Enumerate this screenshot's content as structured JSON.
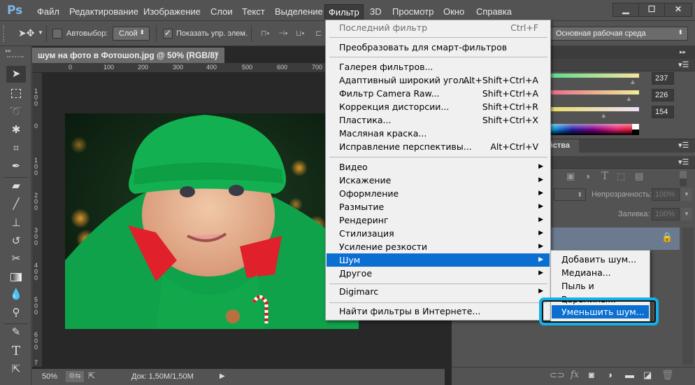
{
  "app": {
    "logo": "Ps"
  },
  "menubar": {
    "items": [
      "Файл",
      "Редактирование",
      "Изображение",
      "Слои",
      "Текст",
      "Выделение",
      "Фильтр",
      "3D",
      "Просмотр",
      "Окно",
      "Справка"
    ],
    "active": "Фильтр"
  },
  "window_controls": {
    "minimize": "▁",
    "maximize": "☐",
    "close": "✕"
  },
  "options_bar": {
    "autoselect_label": "Автовыбор:",
    "autoselect_checked": false,
    "autoselect_target": "Слой",
    "show_transform_label": "Показать упр. элем.",
    "show_transform_checked": true,
    "workspace": "Основная рабочая среда"
  },
  "document": {
    "tab_title": "шум на фото в Фотошоп.jpg @ 50% (RGB/8)",
    "close": "×",
    "ruler_h": [
      "0",
      "100",
      "200",
      "300",
      "400",
      "500",
      "600",
      "700"
    ],
    "ruler_v": [
      "100",
      "0",
      "100",
      "200",
      "300",
      "400",
      "500",
      "600",
      "7"
    ]
  },
  "statusbar": {
    "zoom": "50%",
    "doc_info": "Док: 1,50M/1,50M",
    "arrow": "▶"
  },
  "toolbox": {
    "tools": [
      "move-tool",
      "marquee-tool",
      "lasso-tool",
      "magic-wand-tool",
      "crop-tool",
      "eyedropper-tool",
      "healing-brush-tool",
      "brush-tool",
      "clone-stamp-tool",
      "history-brush-tool",
      "eraser-tool",
      "gradient-tool",
      "blur-tool",
      "dodge-tool",
      "pen-tool",
      "type-tool",
      "path-selection-tool"
    ]
  },
  "filter_menu": {
    "items": [
      {
        "label": "Последний фильтр",
        "shortcut": "Ctrl+F",
        "disabled": true
      },
      {
        "separator": true
      },
      {
        "label": "Преобразовать для смарт-фильтров"
      },
      {
        "separator": true
      },
      {
        "label": "Галерея фильтров..."
      },
      {
        "label": "Адаптивный широкий угол...",
        "shortcut": "Alt+Shift+Ctrl+A"
      },
      {
        "label": "Фильтр Camera Raw...",
        "shortcut": "Shift+Ctrl+A"
      },
      {
        "label": "Коррекция дисторсии...",
        "shortcut": "Shift+Ctrl+R"
      },
      {
        "label": "Пластика...",
        "shortcut": "Shift+Ctrl+X"
      },
      {
        "label": "Масляная краска..."
      },
      {
        "label": "Исправление перспективы...",
        "shortcut": "Alt+Ctrl+V"
      },
      {
        "separator": true
      },
      {
        "label": "Видео",
        "submenu": true
      },
      {
        "label": "Искажение",
        "submenu": true
      },
      {
        "label": "Оформление",
        "submenu": true
      },
      {
        "label": "Размытие",
        "submenu": true
      },
      {
        "label": "Рендеринг",
        "submenu": true
      },
      {
        "label": "Стилизация",
        "submenu": true
      },
      {
        "label": "Усиление резкости",
        "submenu": true
      },
      {
        "label": "Шум",
        "submenu": true,
        "highlighted": true
      },
      {
        "label": "Другое",
        "submenu": true
      },
      {
        "separator": true
      },
      {
        "label": "Digimarc",
        "submenu": true
      },
      {
        "separator": true
      },
      {
        "label": "Найти фильтры в Интернете..."
      }
    ]
  },
  "noise_submenu": {
    "items": [
      {
        "label": "Добавить шум..."
      },
      {
        "label": "Медиана..."
      },
      {
        "label": "Пыль и царапины..."
      },
      {
        "label": "Ретушь..."
      },
      {
        "label": "Уменьшить шум...",
        "highlighted": true
      }
    ]
  },
  "color_panel": {
    "values": [
      "237",
      "226",
      "154"
    ],
    "slider_fraction": [
      0.93,
      0.886,
      0.604
    ]
  },
  "properties_panel": {
    "tab_label": "йства"
  },
  "layers_panel": {
    "opacity_label": "Непрозрачность:",
    "opacity_value": "100%",
    "fill_label": "Заливка:",
    "fill_value": "100%"
  },
  "colors": {
    "accent": "#0a6fd0",
    "highlight_frame": "#14b0e8",
    "layer_selected": "#6b7a8f"
  }
}
